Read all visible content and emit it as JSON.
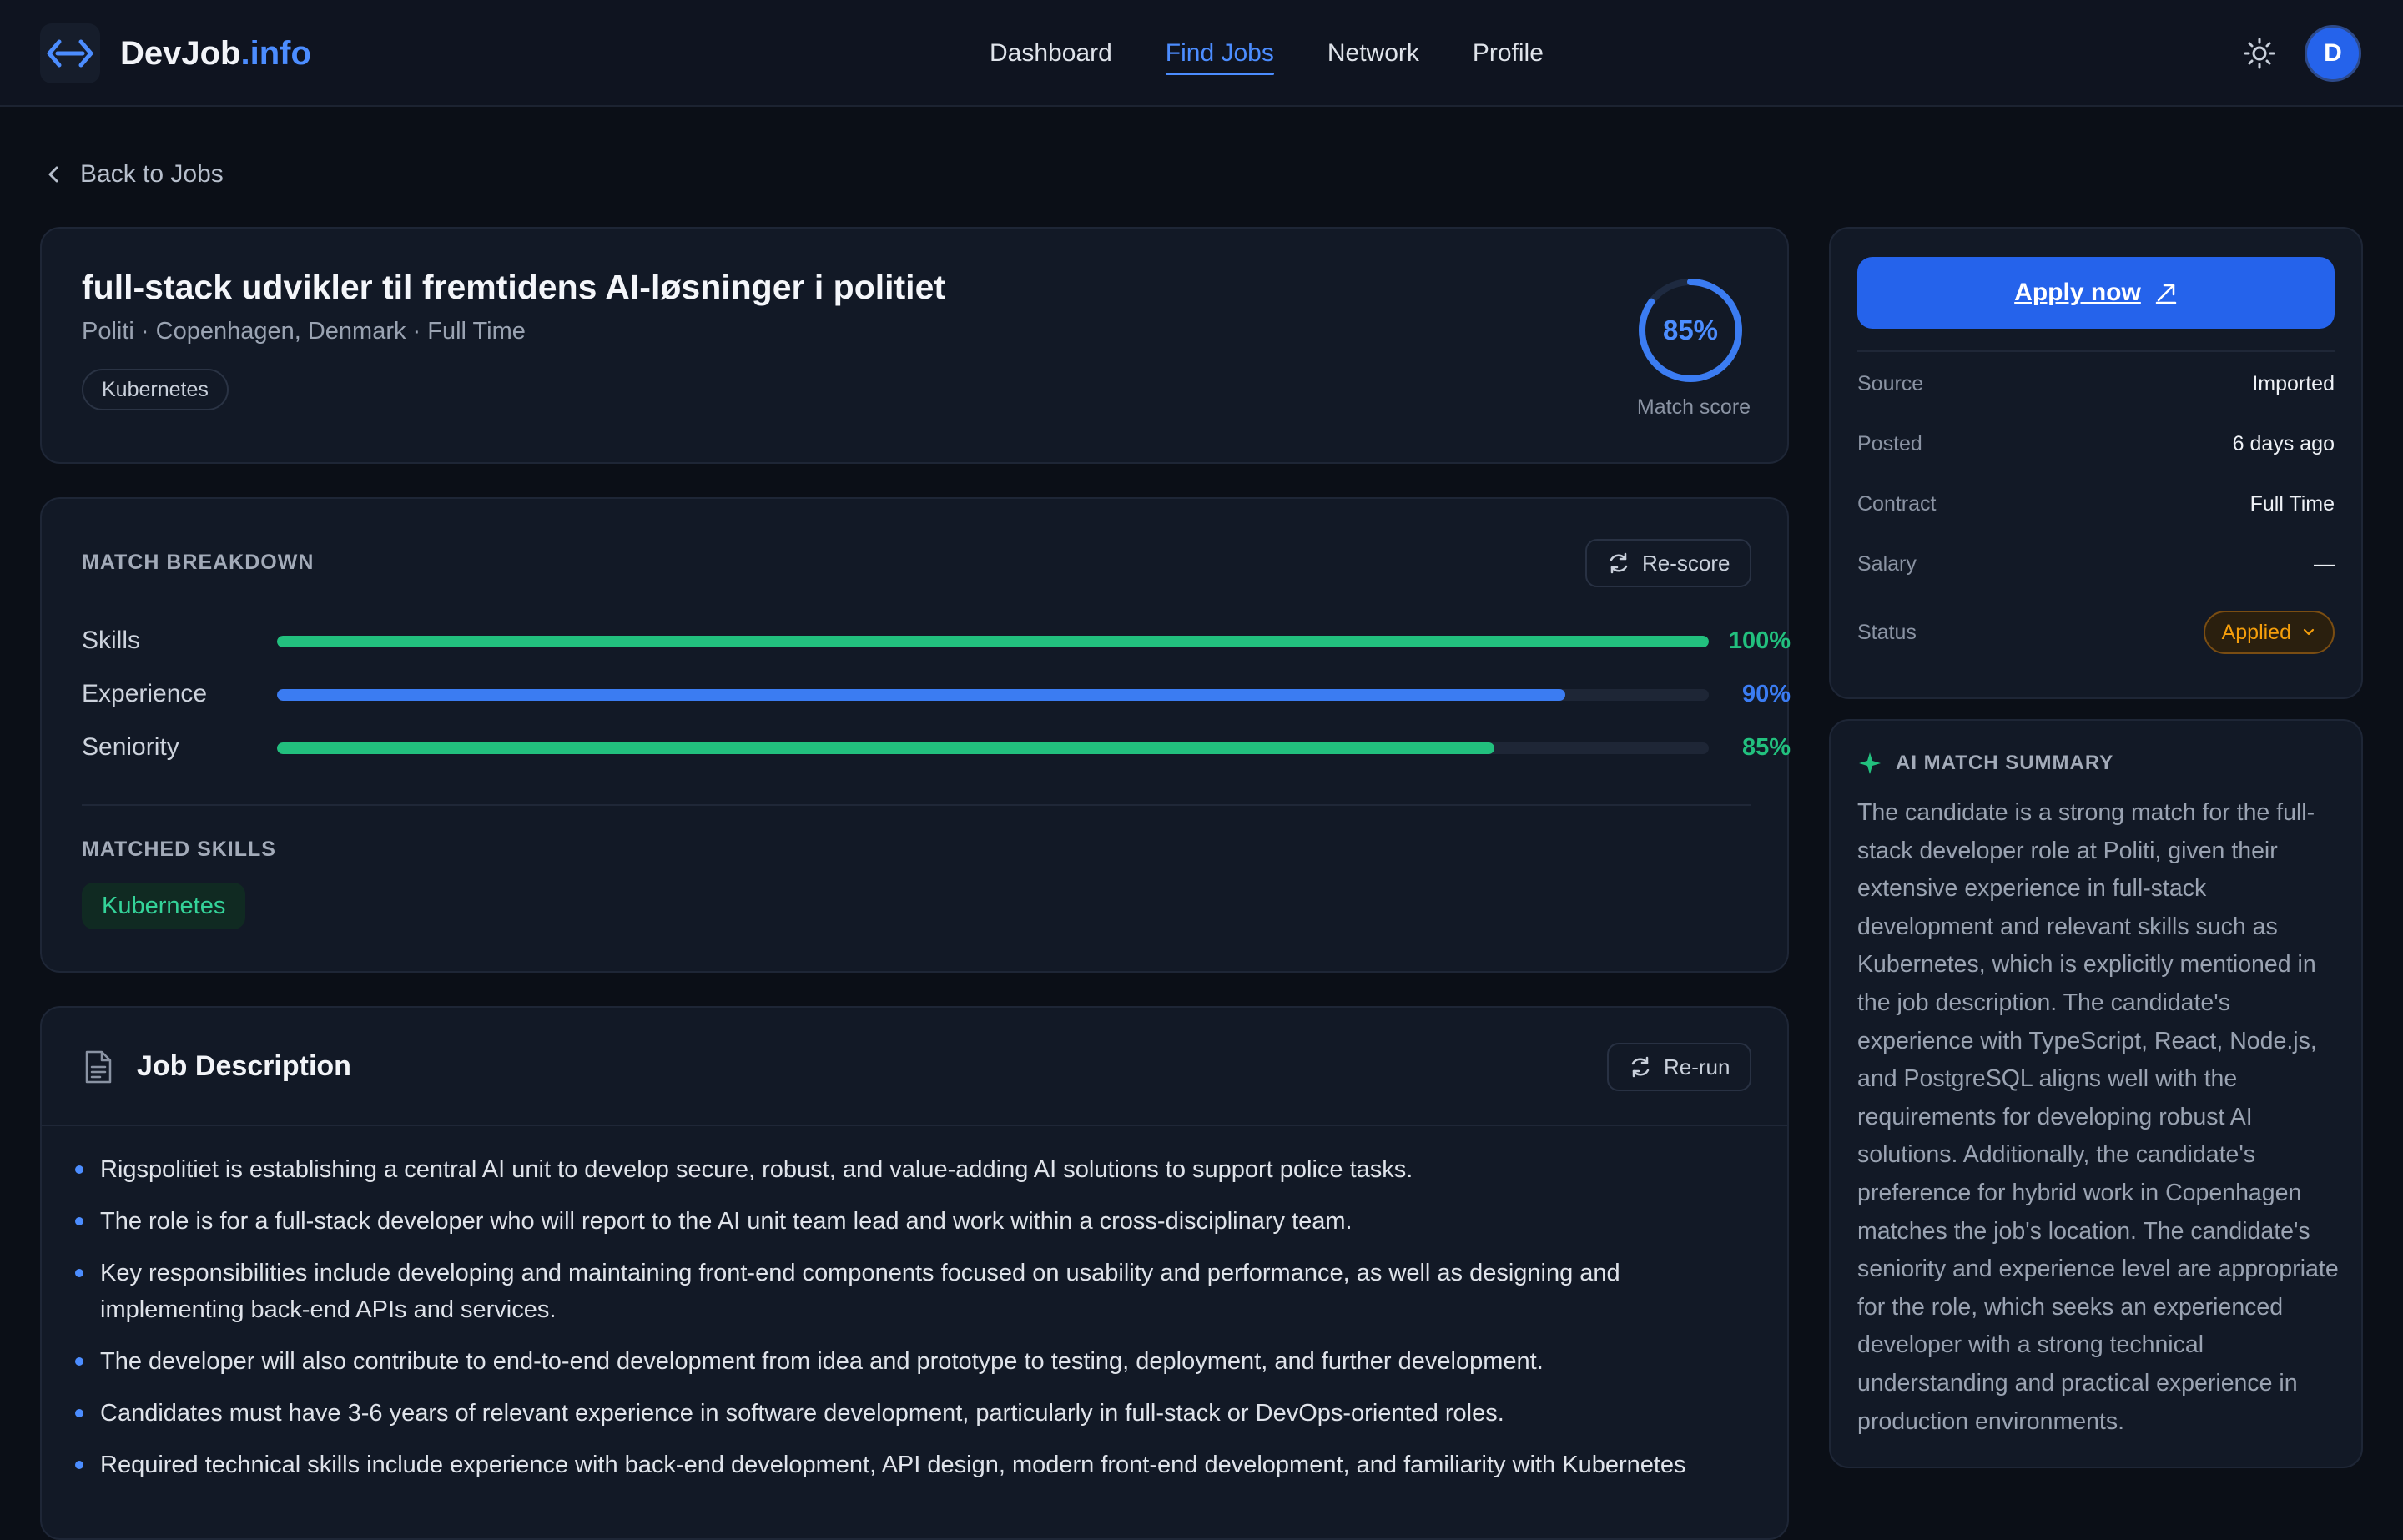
{
  "brand": {
    "name_main": "DevJob",
    "name_suffix": ".info"
  },
  "nav": [
    {
      "label": "Dashboard",
      "active": false
    },
    {
      "label": "Find Jobs",
      "active": true
    },
    {
      "label": "Network",
      "active": false
    },
    {
      "label": "Profile",
      "active": false
    }
  ],
  "user": {
    "avatar_initial": "D"
  },
  "back": {
    "label": "Back to Jobs"
  },
  "job": {
    "title": "full-stack udvikler til fremtidens AI-løsninger i politiet",
    "meta": "Politi · Copenhagen, Denmark · Full Time",
    "tag": "Kubernetes",
    "match_score": "85%",
    "match_score_value": 0.85,
    "match_label": "Match score"
  },
  "breakdown": {
    "heading": "MATCH BREAKDOWN",
    "rescore_label": "Re-score",
    "rows": [
      {
        "label": "Skills",
        "pct": "100%",
        "value": 1.0,
        "color": "#22c07e"
      },
      {
        "label": "Experience",
        "pct": "90%",
        "value": 0.9,
        "color": "#3b7cf2"
      },
      {
        "label": "Seniority",
        "pct": "85%",
        "value": 0.85,
        "color": "#22c07e"
      }
    ],
    "matched_heading": "MATCHED SKILLS",
    "matched_skills": [
      "Kubernetes"
    ]
  },
  "description": {
    "heading": "Job Description",
    "rerun_label": "Re-run",
    "bullets": [
      "Rigspolitiet is establishing a central AI unit to develop secure, robust, and value-adding AI solutions to support police tasks.",
      "The role is for a full-stack developer who will report to the AI unit team lead and work within a cross-disciplinary team.",
      "Key responsibilities include developing and maintaining front-end components focused on usability and performance, as well as designing and implementing back-end APIs and services.",
      "The developer will also contribute to end-to-end development from idea and prototype to testing, deployment, and further development.",
      "Candidates must have 3-6 years of relevant experience in software development, particularly in full-stack or DevOps-oriented roles.",
      "Required technical skills include experience with back-end development, API design, modern front-end development, and familiarity with Kubernetes"
    ]
  },
  "sidebar": {
    "apply_label": "Apply now",
    "info": [
      {
        "key": "Source",
        "value": "Imported"
      },
      {
        "key": "Posted",
        "value": "6 days ago"
      },
      {
        "key": "Contract",
        "value": "Full Time"
      },
      {
        "key": "Salary",
        "value": "—"
      }
    ],
    "status_key": "Status",
    "status_value": "Applied"
  },
  "summary": {
    "heading": "AI MATCH SUMMARY",
    "text": "The candidate is a strong match for the full-stack developer role at Politi, given their extensive experience in full-stack development and relevant skills such as Kubernetes, which is explicitly mentioned in the job description. The candidate's experience with TypeScript, React, Node.js, and PostgreSQL aligns well with the requirements for developing robust AI solutions. Additionally, the candidate's preference for hybrid work in Copenhagen matches the job's location. The candidate's seniority and experience level are appropriate for the role, which seeks an experienced developer with a strong technical understanding and practical experience in production environments."
  },
  "colors": {
    "accent": "#4c8dff",
    "primary_button": "#2563eb",
    "success": "#22c07e",
    "warning": "#f59e0b"
  },
  "icons": [
    "code-brackets-icon",
    "sun-icon",
    "chevron-left-icon",
    "refresh-icon",
    "document-icon",
    "external-link-icon",
    "chevron-down-icon",
    "sparkle-icon"
  ]
}
